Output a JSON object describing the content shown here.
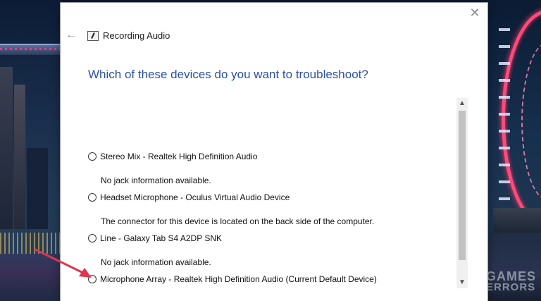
{
  "window": {
    "title": "Recording Audio",
    "close_label": "✕",
    "back_label": "←"
  },
  "heading": "Which of these devices do you want to troubleshoot?",
  "devices": [
    {
      "label": "Stereo Mix - Realtek High Definition Audio",
      "description": "No jack information available.",
      "selected": false
    },
    {
      "label": "Headset Microphone - Oculus Virtual Audio Device",
      "description": "The connector for this device is located on the back side of the computer.",
      "selected": false
    },
    {
      "label": "Line - Galaxy Tab S4 A2DP SNK",
      "description": "No jack information available.",
      "selected": false
    },
    {
      "label": "Microphone Array - Realtek High Definition Audio (Current Default Device)",
      "description": "",
      "selected": false
    }
  ],
  "scrollbar": {
    "up_glyph": "▲",
    "down_glyph": "▼"
  },
  "watermark": {
    "line1": "GAMES",
    "line2": "ERRORS"
  },
  "colors": {
    "heading": "#2b4fa3",
    "annotation_arrow": "#e0344f"
  },
  "icons": [
    "close-icon",
    "back-arrow-icon",
    "microphone-troubleshooter-icon",
    "annotation-arrow-icon"
  ]
}
